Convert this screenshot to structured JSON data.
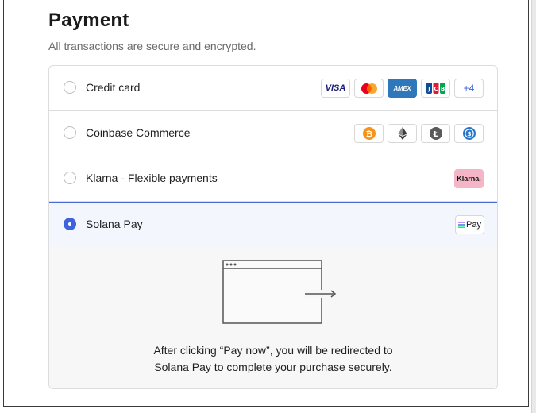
{
  "header": {
    "title": "Payment",
    "subtitle": "All transactions are secure and encrypted."
  },
  "methods": [
    {
      "label": "Credit card",
      "selected": false,
      "badges": [
        {
          "name": "visa-logo",
          "text": "VISA"
        },
        {
          "name": "mastercard-logo",
          "text": ""
        },
        {
          "name": "amex-logo",
          "text": "AMEX"
        },
        {
          "name": "jcb-logo",
          "text": "JCB"
        },
        {
          "name": "more-cards-badge",
          "text": "+4"
        }
      ]
    },
    {
      "label": "Coinbase Commerce",
      "selected": false,
      "badges": [
        {
          "name": "bitcoin-icon",
          "text": ""
        },
        {
          "name": "ethereum-icon",
          "text": ""
        },
        {
          "name": "litecoin-icon",
          "text": ""
        },
        {
          "name": "usdc-icon",
          "text": ""
        }
      ]
    },
    {
      "label": "Klarna - Flexible payments",
      "selected": false,
      "badges": [
        {
          "name": "klarna-logo",
          "text": "Klarna."
        }
      ]
    },
    {
      "label": "Solana Pay",
      "selected": true,
      "badges": [
        {
          "name": "solana-pay-logo",
          "text": "Pay"
        }
      ]
    }
  ],
  "redirect": {
    "line1": "After clicking “Pay now”, you will be redirected to",
    "line2": "Solana Pay to complete your purchase securely."
  },
  "colors": {
    "accent": "#3d63dd",
    "selected_bg": "#f4f6fd",
    "details_bg": "#f7f7f7"
  }
}
